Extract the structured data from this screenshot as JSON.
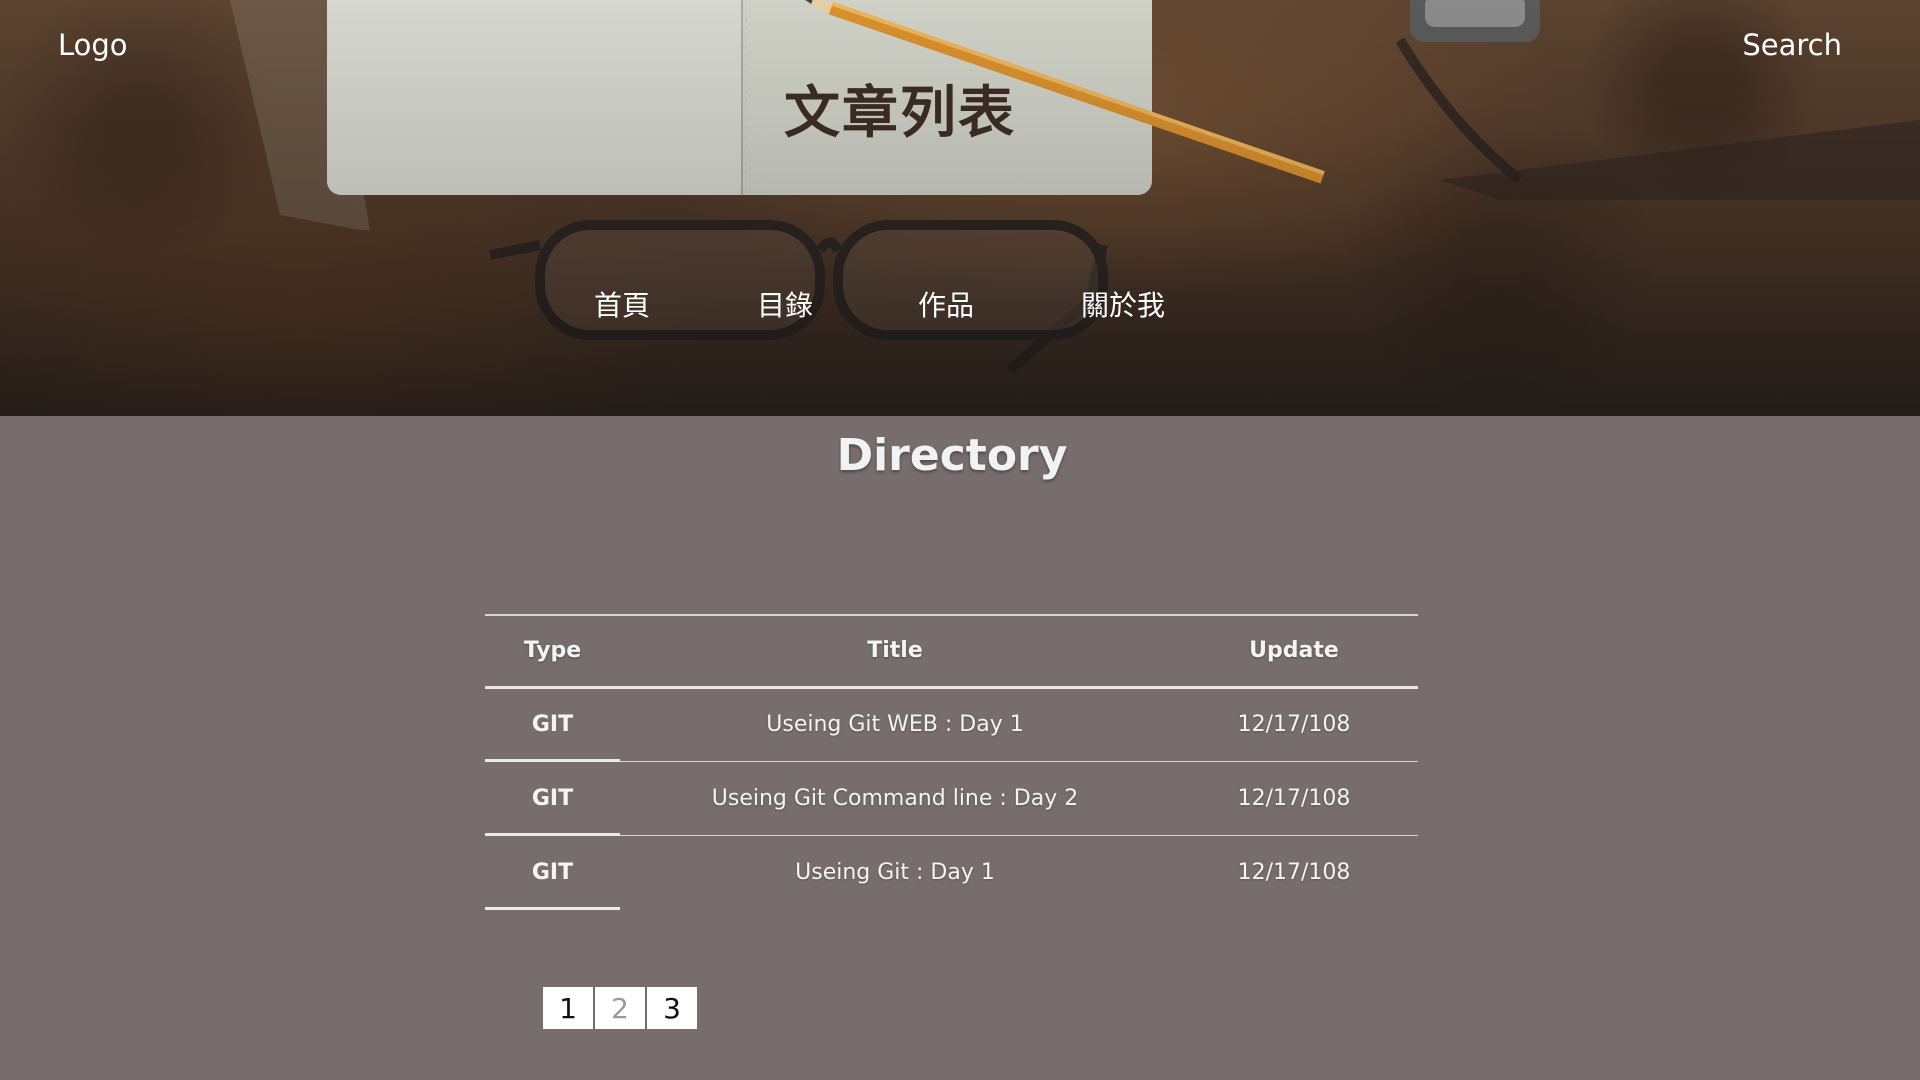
{
  "header": {
    "logo": "Logo",
    "search": "Search",
    "title": "文章列表",
    "nav": [
      {
        "label": "首頁"
      },
      {
        "label": "目錄"
      },
      {
        "label": "作品"
      },
      {
        "label": "關於我"
      }
    ]
  },
  "main": {
    "section_title": "Directory",
    "table": {
      "columns": [
        "Type",
        "Title",
        "Update"
      ],
      "rows": [
        {
          "type": "GIT",
          "title": "Useing Git WEB : Day 1",
          "update": "12/17/108"
        },
        {
          "type": "GIT",
          "title": "Useing Git Command line : Day 2",
          "update": "12/17/108"
        },
        {
          "type": "GIT",
          "title": "Useing Git : Day 1",
          "update": "12/17/108"
        }
      ]
    },
    "pagination": {
      "pages": [
        "1",
        "2",
        "3"
      ],
      "current": "2"
    }
  },
  "colors": {
    "page_background": "#786d6d",
    "title_text": "#3a2a24",
    "table_text": "#f4f4f4"
  }
}
